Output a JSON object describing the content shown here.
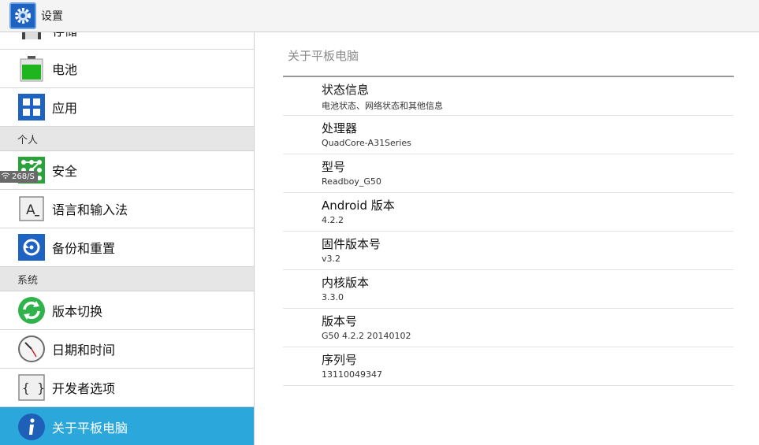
{
  "app": {
    "title": "设置"
  },
  "sidebar": {
    "items": [
      {
        "label": "存储",
        "icon": "storage-icon"
      },
      {
        "label": "电池",
        "icon": "battery-icon"
      },
      {
        "label": "应用",
        "icon": "apps-icon"
      },
      {
        "label": "安全",
        "icon": "security-icon"
      },
      {
        "label": "语言和输入法",
        "icon": "language-icon"
      },
      {
        "label": "备份和重置",
        "icon": "backup-icon"
      },
      {
        "label": "版本切换",
        "icon": "version-switch-icon"
      },
      {
        "label": "日期和时间",
        "icon": "clock-icon"
      },
      {
        "label": "开发者选项",
        "icon": "developer-icon"
      },
      {
        "label": "关于平板电脑",
        "icon": "info-icon"
      }
    ],
    "headers": {
      "personal": "个人",
      "system": "系统"
    },
    "net_speed": "268/S"
  },
  "detail": {
    "title": "关于平板电脑",
    "rows": [
      {
        "title": "状态信息",
        "subtitle": "电池状态、网络状态和其他信息"
      },
      {
        "title": "处理器",
        "subtitle": "QuadCore-A31Series"
      },
      {
        "title": "型号",
        "subtitle": "Readboy_G50"
      },
      {
        "title": "Android 版本",
        "subtitle": "4.2.2"
      },
      {
        "title": "固件版本号",
        "subtitle": "v3.2"
      },
      {
        "title": "内核版本",
        "subtitle": "3.3.0"
      },
      {
        "title": "版本号",
        "subtitle": "G50 4.2.2 20140102"
      },
      {
        "title": "序列号",
        "subtitle": "13110049347"
      }
    ]
  },
  "colors": {
    "accent": "#2ca7dc",
    "battery_green": "#1fb51f",
    "blue_tile": "#1e63c2"
  }
}
